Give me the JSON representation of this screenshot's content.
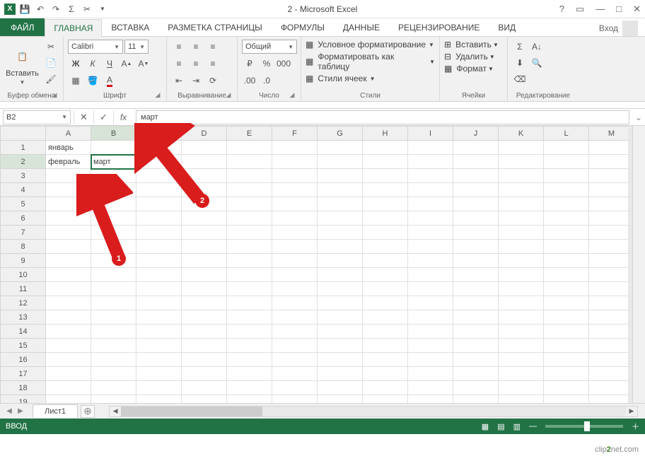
{
  "title": "2 - Microsoft Excel",
  "tabs": {
    "file": "ФАЙЛ",
    "home": "ГЛАВНАЯ",
    "insert": "ВСТАВКА",
    "layout": "РАЗМЕТКА СТРАНИЦЫ",
    "formulas": "ФОРМУЛЫ",
    "data": "ДАННЫЕ",
    "review": "РЕЦЕНЗИРОВАНИЕ",
    "view": "ВИД",
    "login": "Вход"
  },
  "ribbon": {
    "clipboard": {
      "paste": "Вставить",
      "label": "Буфер обмена"
    },
    "font": {
      "name": "Calibri",
      "size": "11",
      "bold": "Ж",
      "italic": "К",
      "underline": "Ч",
      "label": "Шрифт"
    },
    "align": {
      "label": "Выравнивание"
    },
    "number": {
      "format": "Общий",
      "label": "Число"
    },
    "styles": {
      "cond": "Условное форматирование",
      "table": "Форматировать как таблицу",
      "cell": "Стили ячеек",
      "label": "Стили"
    },
    "cells": {
      "insert": "Вставить",
      "delete": "Удалить",
      "format": "Формат",
      "label": "Ячейки"
    },
    "editing": {
      "label": "Редактирование"
    }
  },
  "formula_bar": {
    "name_box": "B2",
    "fx": "fx",
    "value": "март"
  },
  "columns": [
    "A",
    "B",
    "C",
    "D",
    "E",
    "F",
    "G",
    "H",
    "I",
    "J",
    "K",
    "L",
    "M"
  ],
  "rows_count": 19,
  "active_cell": "B2",
  "cells": {
    "A1": "январь",
    "A2": "февраль",
    "B2": "март"
  },
  "sheet": {
    "name": "Лист1"
  },
  "status": {
    "mode": "ВВОД",
    "zoom": "100%"
  },
  "annotations": {
    "a1": "1",
    "a2": "2"
  },
  "watermark": {
    "pre": "clip",
    "mid": "2",
    "post": "net",
    "suf": ".com"
  }
}
